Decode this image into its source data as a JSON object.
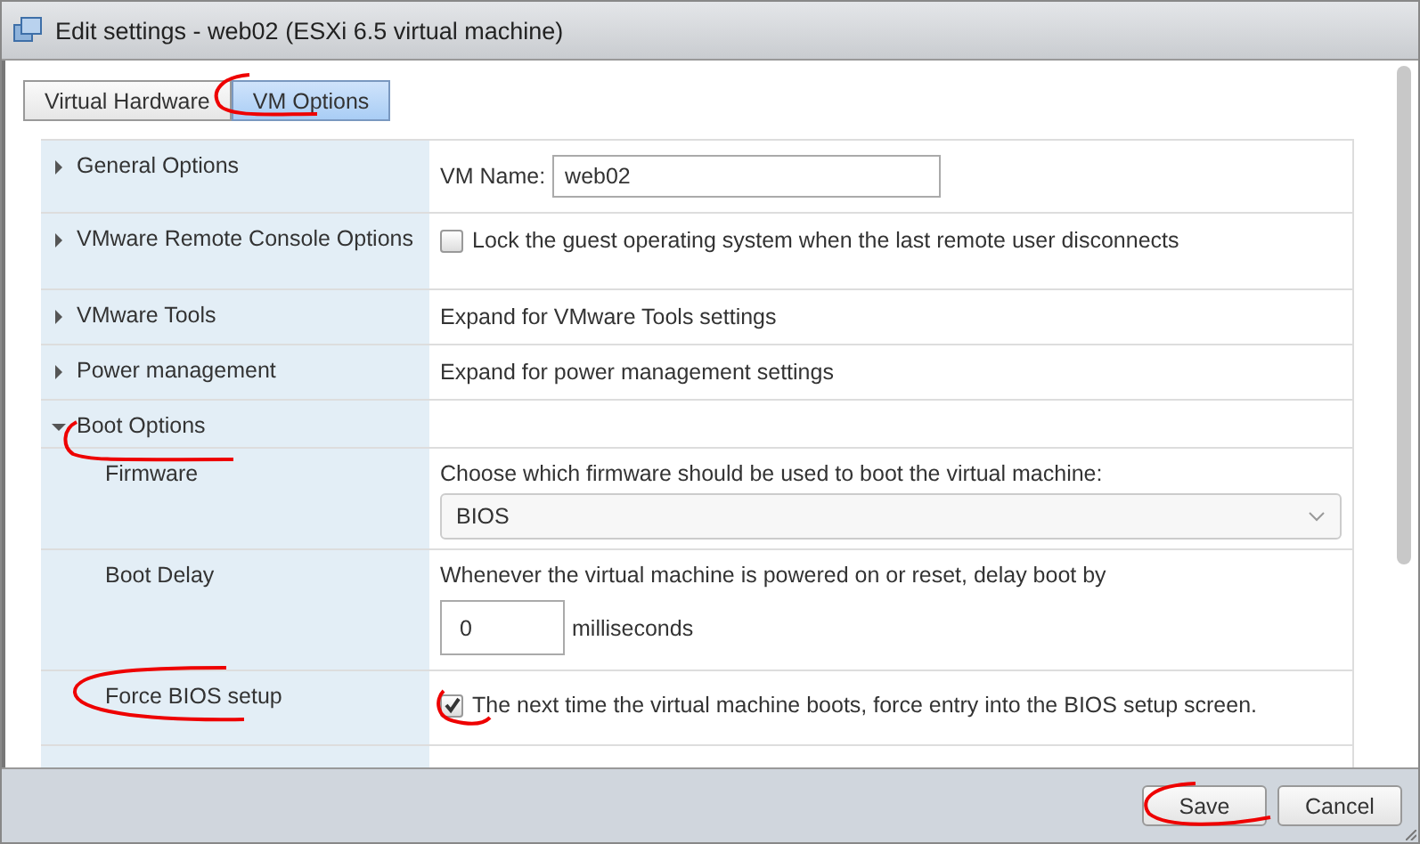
{
  "window": {
    "title": "Edit settings - web02 (ESXi 6.5 virtual machine)"
  },
  "tabs": [
    {
      "label": "Virtual Hardware",
      "selected": false
    },
    {
      "label": "VM Options",
      "selected": true
    }
  ],
  "rows": [
    {
      "kind": "section",
      "label": "General Options",
      "expanded": false,
      "detail": {
        "kind": "field",
        "label": "VM Name:",
        "value": "web02"
      }
    },
    {
      "kind": "section",
      "label": "VMware Remote Console Options",
      "expanded": false,
      "detail": {
        "kind": "checkbox",
        "checked": false,
        "text": "Lock the guest operating system when the last remote user disconnects"
      }
    },
    {
      "kind": "section",
      "label": "VMware Tools",
      "expanded": false,
      "detail": {
        "kind": "text",
        "text": "Expand for VMware Tools settings"
      }
    },
    {
      "kind": "section",
      "label": "Power management",
      "expanded": false,
      "detail": {
        "kind": "text",
        "text": "Expand for power management settings"
      }
    },
    {
      "kind": "section",
      "label": "Boot Options",
      "expanded": true
    },
    {
      "kind": "subsection",
      "label": "Firmware",
      "detail": {
        "kind": "select",
        "text": "Choose which firmware should be used to boot the virtual machine:",
        "value": "BIOS"
      }
    },
    {
      "kind": "subsection",
      "label": "Boot Delay",
      "detail": {
        "kind": "delay",
        "text": "Whenever the virtual machine is powered on or reset, delay boot by",
        "value": "0",
        "unit": "milliseconds"
      }
    },
    {
      "kind": "subsection",
      "label": "Force BIOS setup",
      "detail": {
        "kind": "checkbox",
        "checked": true,
        "text": "The next time the virtual machine boots, force entry into the BIOS setup screen."
      }
    }
  ],
  "buttons": [
    {
      "label": "Save"
    },
    {
      "label": "Cancel"
    }
  ]
}
